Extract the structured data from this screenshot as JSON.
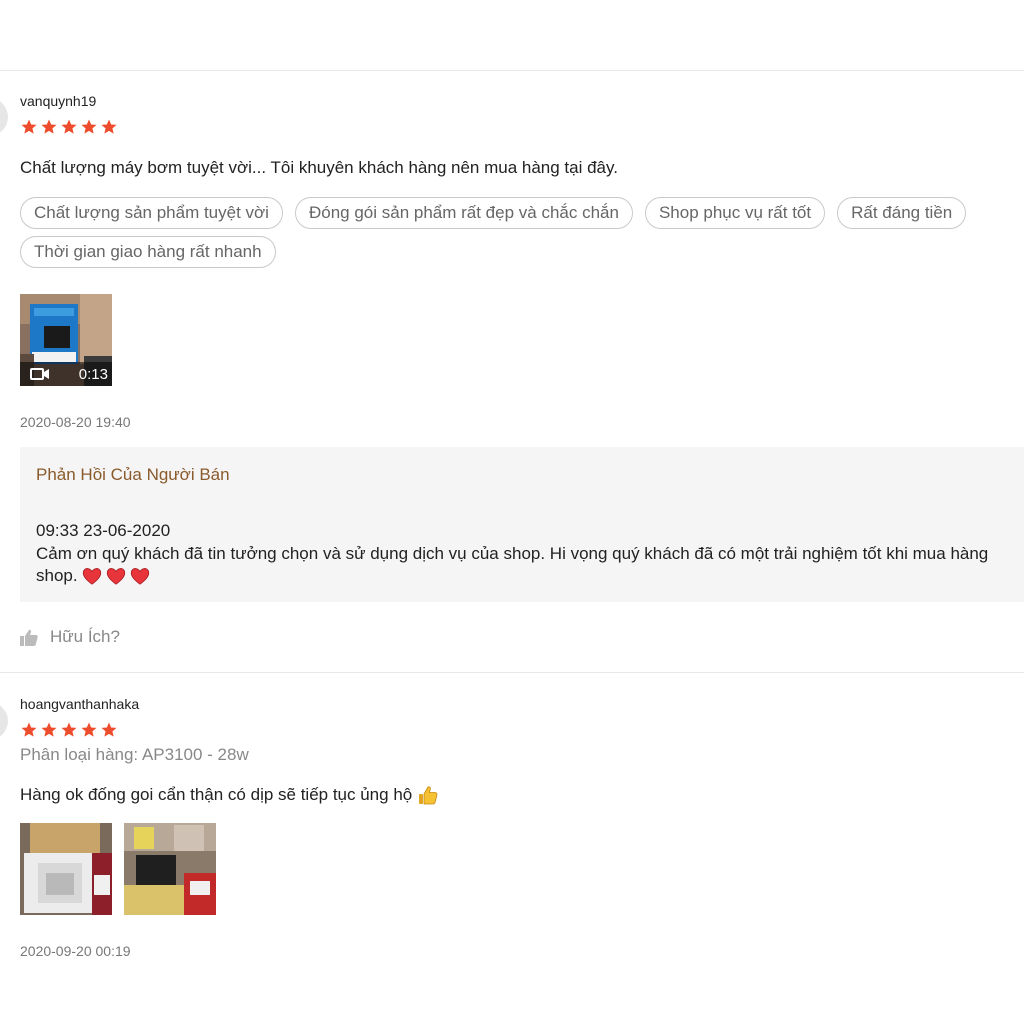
{
  "reviews": [
    {
      "username": "vanquynh19",
      "rating": 5,
      "text": "Chất lượng máy bơm tuyệt vời... Tôi khuyên khách hàng nên mua hàng tại đây.",
      "tags": [
        "Chất lượng sản phẩm tuyệt vời",
        "Đóng gói sản phẩm rất đẹp và chắc chắn",
        "Shop phục vụ rất tốt",
        "Rất đáng tiền",
        "Thời gian giao hàng rất nhanh"
      ],
      "video_duration": "0:13",
      "date": "2020-08-20 19:40",
      "seller_reply": {
        "title": "Phản Hồi Của Người Bán",
        "time": "09:33 23-06-2020",
        "text_line1": "Cảm ơn quý khách đã tin tưởng chọn và sử dụng dịch vụ của shop. Hi vọng quý khách đã có một trải nghiệm tốt khi mua hàng",
        "text_line2": "shop."
      },
      "helpful_label": "Hữu Ích?"
    },
    {
      "username": "hoangvanthanhaka",
      "rating": 5,
      "variation": "Phân loại hàng: AP3100 - 28w",
      "text": "Hàng ok đống goi cẩn thận có dịp sẽ tiếp tục ủng hộ",
      "date": "2020-09-20 00:19"
    }
  ],
  "colors": {
    "star": "#ee4d2d",
    "reply_title": "#8a5a2b",
    "heart": "#e8343b"
  },
  "icons": [
    "star-icon",
    "video-camera-icon",
    "heart-icon",
    "thumbs-up-icon"
  ]
}
